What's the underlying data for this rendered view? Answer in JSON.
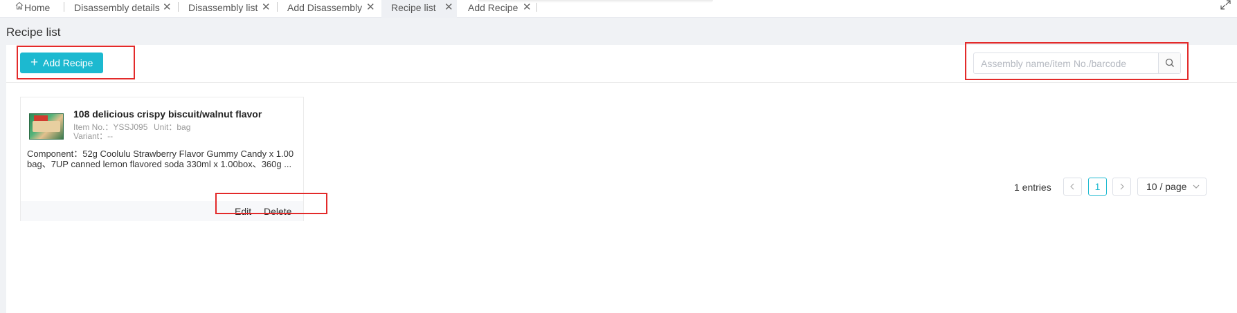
{
  "tabs": [
    {
      "label": "Home",
      "closable": false,
      "active": false
    },
    {
      "label": "Disassembly details",
      "closable": true,
      "active": false
    },
    {
      "label": "Disassembly list",
      "closable": true,
      "active": false
    },
    {
      "label": "Add Disassembly",
      "closable": true,
      "active": false
    },
    {
      "label": "Recipe list",
      "closable": true,
      "active": true
    },
    {
      "label": "Add Recipe",
      "closable": true,
      "active": false
    }
  ],
  "page": {
    "title": "Recipe list"
  },
  "toolbar": {
    "add_label": "Add Recipe"
  },
  "search": {
    "placeholder": "Assembly name/item No./barcode",
    "value": ""
  },
  "recipes": [
    {
      "title": "108 delicious crispy biscuit/walnut flavor",
      "item_no": "Item No.：YSSJ095",
      "unit": "Unit：bag",
      "variant": "Variant：--",
      "components": "Component：52g Coolulu Strawberry Flavor Gummy Candy x 1.00 bag、7UP canned lemon flavored soda 330ml x 1.00box、360g ...",
      "edit_label": "Edit",
      "delete_label": "Delete"
    }
  ],
  "pagination": {
    "total": "1 entries",
    "current_page": "1",
    "page_size": "10 / page"
  },
  "colors": {
    "accent": "#1cb9d0",
    "highlight": "#e32a2a"
  }
}
